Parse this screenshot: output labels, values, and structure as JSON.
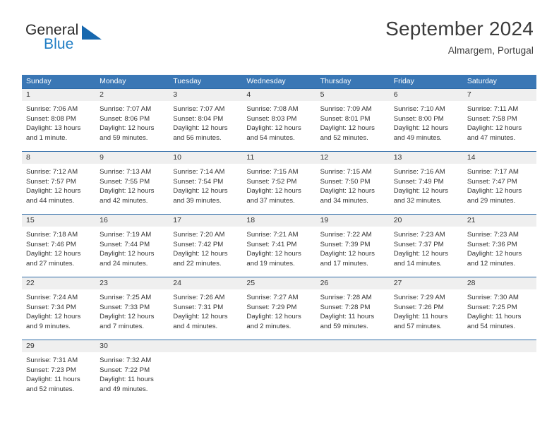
{
  "brand": {
    "name_part1": "General",
    "name_part2": "Blue",
    "mark_icon": "blue-triangle-sail-icon",
    "accent_color": "#1f7dc4"
  },
  "header": {
    "title": "September 2024",
    "location": "Almargem, Portugal"
  },
  "theme": {
    "header_blue": "#3a77b5",
    "border_blue": "#2f6ca8",
    "day_band_gray": "#efefef",
    "text_color": "#333333"
  },
  "weekdays": [
    "Sunday",
    "Monday",
    "Tuesday",
    "Wednesday",
    "Thursday",
    "Friday",
    "Saturday"
  ],
  "weeks": [
    [
      {
        "day": "1",
        "sunrise": "Sunrise: 7:06 AM",
        "sunset": "Sunset: 8:08 PM",
        "daylight_line1": "Daylight: 13 hours",
        "daylight_line2": "and 1 minute."
      },
      {
        "day": "2",
        "sunrise": "Sunrise: 7:07 AM",
        "sunset": "Sunset: 8:06 PM",
        "daylight_line1": "Daylight: 12 hours",
        "daylight_line2": "and 59 minutes."
      },
      {
        "day": "3",
        "sunrise": "Sunrise: 7:07 AM",
        "sunset": "Sunset: 8:04 PM",
        "daylight_line1": "Daylight: 12 hours",
        "daylight_line2": "and 56 minutes."
      },
      {
        "day": "4",
        "sunrise": "Sunrise: 7:08 AM",
        "sunset": "Sunset: 8:03 PM",
        "daylight_line1": "Daylight: 12 hours",
        "daylight_line2": "and 54 minutes."
      },
      {
        "day": "5",
        "sunrise": "Sunrise: 7:09 AM",
        "sunset": "Sunset: 8:01 PM",
        "daylight_line1": "Daylight: 12 hours",
        "daylight_line2": "and 52 minutes."
      },
      {
        "day": "6",
        "sunrise": "Sunrise: 7:10 AM",
        "sunset": "Sunset: 8:00 PM",
        "daylight_line1": "Daylight: 12 hours",
        "daylight_line2": "and 49 minutes."
      },
      {
        "day": "7",
        "sunrise": "Sunrise: 7:11 AM",
        "sunset": "Sunset: 7:58 PM",
        "daylight_line1": "Daylight: 12 hours",
        "daylight_line2": "and 47 minutes."
      }
    ],
    [
      {
        "day": "8",
        "sunrise": "Sunrise: 7:12 AM",
        "sunset": "Sunset: 7:57 PM",
        "daylight_line1": "Daylight: 12 hours",
        "daylight_line2": "and 44 minutes."
      },
      {
        "day": "9",
        "sunrise": "Sunrise: 7:13 AM",
        "sunset": "Sunset: 7:55 PM",
        "daylight_line1": "Daylight: 12 hours",
        "daylight_line2": "and 42 minutes."
      },
      {
        "day": "10",
        "sunrise": "Sunrise: 7:14 AM",
        "sunset": "Sunset: 7:54 PM",
        "daylight_line1": "Daylight: 12 hours",
        "daylight_line2": "and 39 minutes."
      },
      {
        "day": "11",
        "sunrise": "Sunrise: 7:15 AM",
        "sunset": "Sunset: 7:52 PM",
        "daylight_line1": "Daylight: 12 hours",
        "daylight_line2": "and 37 minutes."
      },
      {
        "day": "12",
        "sunrise": "Sunrise: 7:15 AM",
        "sunset": "Sunset: 7:50 PM",
        "daylight_line1": "Daylight: 12 hours",
        "daylight_line2": "and 34 minutes."
      },
      {
        "day": "13",
        "sunrise": "Sunrise: 7:16 AM",
        "sunset": "Sunset: 7:49 PM",
        "daylight_line1": "Daylight: 12 hours",
        "daylight_line2": "and 32 minutes."
      },
      {
        "day": "14",
        "sunrise": "Sunrise: 7:17 AM",
        "sunset": "Sunset: 7:47 PM",
        "daylight_line1": "Daylight: 12 hours",
        "daylight_line2": "and 29 minutes."
      }
    ],
    [
      {
        "day": "15",
        "sunrise": "Sunrise: 7:18 AM",
        "sunset": "Sunset: 7:46 PM",
        "daylight_line1": "Daylight: 12 hours",
        "daylight_line2": "and 27 minutes."
      },
      {
        "day": "16",
        "sunrise": "Sunrise: 7:19 AM",
        "sunset": "Sunset: 7:44 PM",
        "daylight_line1": "Daylight: 12 hours",
        "daylight_line2": "and 24 minutes."
      },
      {
        "day": "17",
        "sunrise": "Sunrise: 7:20 AM",
        "sunset": "Sunset: 7:42 PM",
        "daylight_line1": "Daylight: 12 hours",
        "daylight_line2": "and 22 minutes."
      },
      {
        "day": "18",
        "sunrise": "Sunrise: 7:21 AM",
        "sunset": "Sunset: 7:41 PM",
        "daylight_line1": "Daylight: 12 hours",
        "daylight_line2": "and 19 minutes."
      },
      {
        "day": "19",
        "sunrise": "Sunrise: 7:22 AM",
        "sunset": "Sunset: 7:39 PM",
        "daylight_line1": "Daylight: 12 hours",
        "daylight_line2": "and 17 minutes."
      },
      {
        "day": "20",
        "sunrise": "Sunrise: 7:23 AM",
        "sunset": "Sunset: 7:37 PM",
        "daylight_line1": "Daylight: 12 hours",
        "daylight_line2": "and 14 minutes."
      },
      {
        "day": "21",
        "sunrise": "Sunrise: 7:23 AM",
        "sunset": "Sunset: 7:36 PM",
        "daylight_line1": "Daylight: 12 hours",
        "daylight_line2": "and 12 minutes."
      }
    ],
    [
      {
        "day": "22",
        "sunrise": "Sunrise: 7:24 AM",
        "sunset": "Sunset: 7:34 PM",
        "daylight_line1": "Daylight: 12 hours",
        "daylight_line2": "and 9 minutes."
      },
      {
        "day": "23",
        "sunrise": "Sunrise: 7:25 AM",
        "sunset": "Sunset: 7:33 PM",
        "daylight_line1": "Daylight: 12 hours",
        "daylight_line2": "and 7 minutes."
      },
      {
        "day": "24",
        "sunrise": "Sunrise: 7:26 AM",
        "sunset": "Sunset: 7:31 PM",
        "daylight_line1": "Daylight: 12 hours",
        "daylight_line2": "and 4 minutes."
      },
      {
        "day": "25",
        "sunrise": "Sunrise: 7:27 AM",
        "sunset": "Sunset: 7:29 PM",
        "daylight_line1": "Daylight: 12 hours",
        "daylight_line2": "and 2 minutes."
      },
      {
        "day": "26",
        "sunrise": "Sunrise: 7:28 AM",
        "sunset": "Sunset: 7:28 PM",
        "daylight_line1": "Daylight: 11 hours",
        "daylight_line2": "and 59 minutes."
      },
      {
        "day": "27",
        "sunrise": "Sunrise: 7:29 AM",
        "sunset": "Sunset: 7:26 PM",
        "daylight_line1": "Daylight: 11 hours",
        "daylight_line2": "and 57 minutes."
      },
      {
        "day": "28",
        "sunrise": "Sunrise: 7:30 AM",
        "sunset": "Sunset: 7:25 PM",
        "daylight_line1": "Daylight: 11 hours",
        "daylight_line2": "and 54 minutes."
      }
    ],
    [
      {
        "day": "29",
        "sunrise": "Sunrise: 7:31 AM",
        "sunset": "Sunset: 7:23 PM",
        "daylight_line1": "Daylight: 11 hours",
        "daylight_line2": "and 52 minutes."
      },
      {
        "day": "30",
        "sunrise": "Sunrise: 7:32 AM",
        "sunset": "Sunset: 7:22 PM",
        "daylight_line1": "Daylight: 11 hours",
        "daylight_line2": "and 49 minutes."
      },
      {
        "day": "",
        "sunrise": "",
        "sunset": "",
        "daylight_line1": "",
        "daylight_line2": ""
      },
      {
        "day": "",
        "sunrise": "",
        "sunset": "",
        "daylight_line1": "",
        "daylight_line2": ""
      },
      {
        "day": "",
        "sunrise": "",
        "sunset": "",
        "daylight_line1": "",
        "daylight_line2": ""
      },
      {
        "day": "",
        "sunrise": "",
        "sunset": "",
        "daylight_line1": "",
        "daylight_line2": ""
      },
      {
        "day": "",
        "sunrise": "",
        "sunset": "",
        "daylight_line1": "",
        "daylight_line2": ""
      }
    ]
  ]
}
